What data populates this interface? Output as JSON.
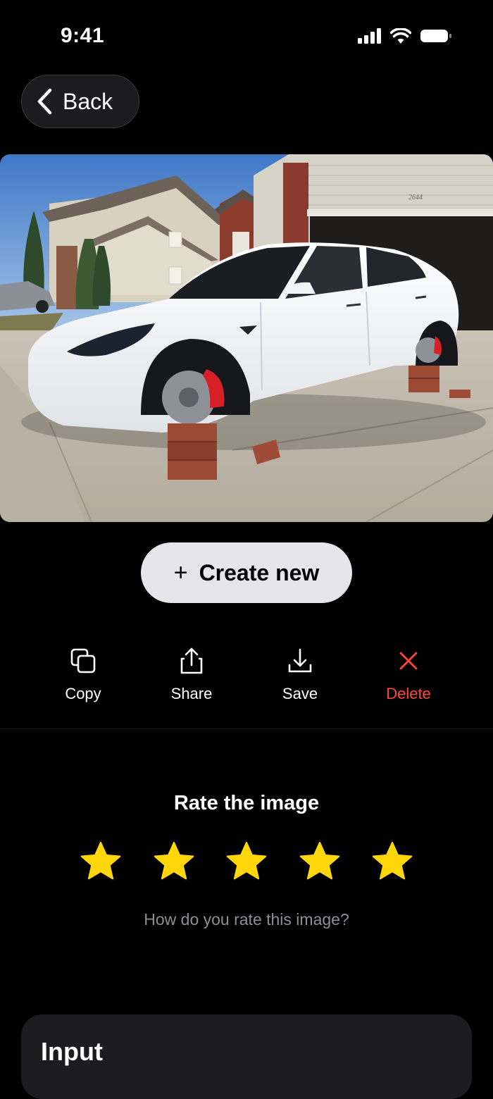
{
  "status_bar": {
    "time": "9:41"
  },
  "nav": {
    "back_label": "Back"
  },
  "main": {
    "create_button": {
      "icon": "plus-icon",
      "label": "Create new"
    },
    "actions": [
      {
        "label": "Copy",
        "icon": "copy-icon",
        "color": "#ffffff"
      },
      {
        "label": "Share",
        "icon": "share-icon",
        "color": "#ffffff"
      },
      {
        "label": "Save",
        "icon": "download-icon",
        "color": "#ffffff"
      },
      {
        "label": "Delete",
        "icon": "close-icon",
        "color": "#ff453a"
      }
    ]
  },
  "rating": {
    "title": "Rate the image",
    "stars_filled": 5,
    "stars_total": 5,
    "star_color": "#ffd60a",
    "hint": "How do you rate this image?"
  },
  "input_section": {
    "title": "Input"
  },
  "photo": {
    "house_number": "2644"
  }
}
